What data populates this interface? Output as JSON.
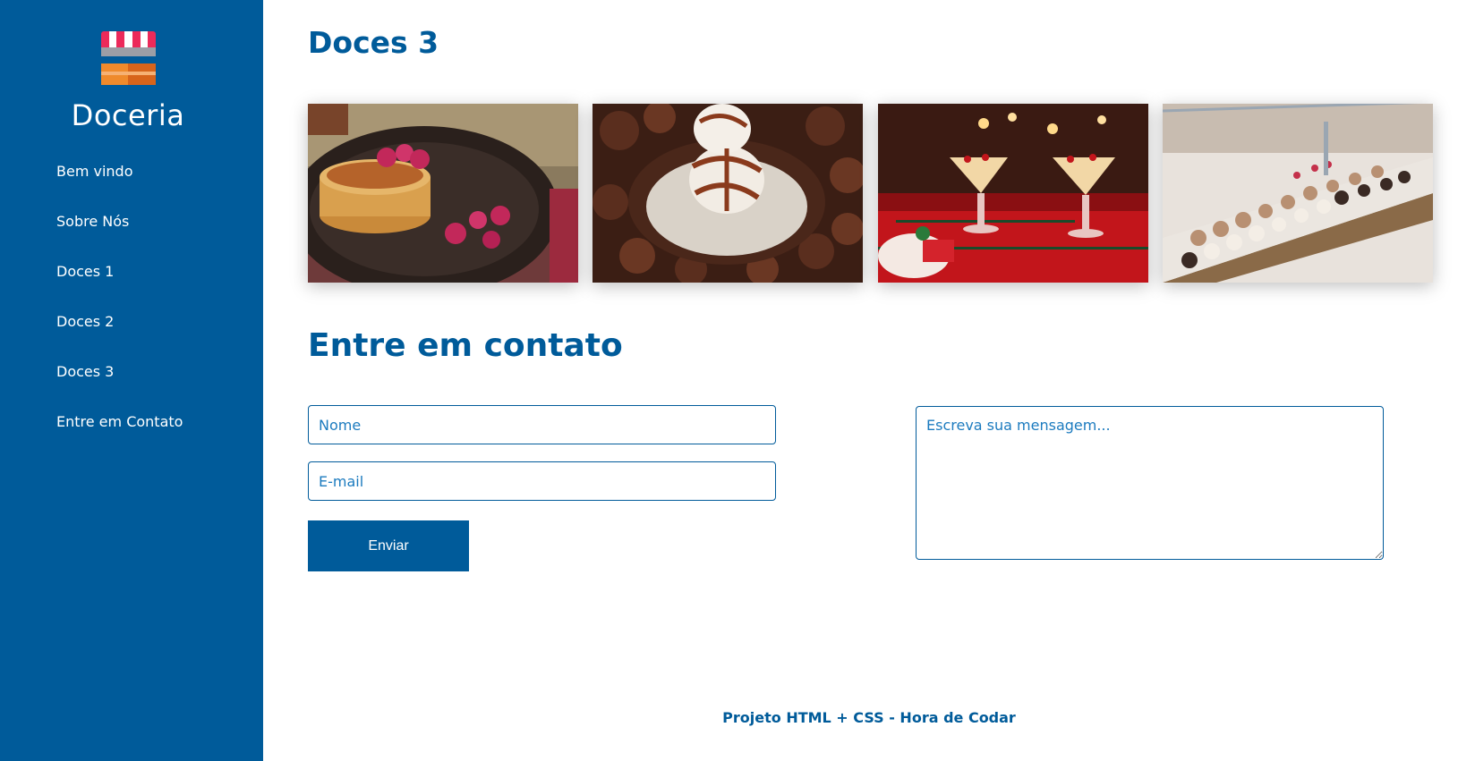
{
  "sidebar": {
    "brand": "Doceria",
    "logo_icon": "sweet-shop-stall-icon",
    "items": [
      {
        "label": "Bem vindo"
      },
      {
        "label": "Sobre Nós"
      },
      {
        "label": "Doces 1"
      },
      {
        "label": "Doces 2"
      },
      {
        "label": "Doces 3"
      },
      {
        "label": "Entre em Contato"
      }
    ]
  },
  "main": {
    "section_title": "Doces 3",
    "gallery": [
      {
        "name": "pancakes-with-raspberries-photo"
      },
      {
        "name": "chocolate-coconut-dessert-photo"
      },
      {
        "name": "christmas-eggnog-cocktails-photo"
      },
      {
        "name": "bakery-display-case-photo"
      }
    ],
    "contact": {
      "title": "Entre em contato",
      "name_placeholder": "Nome",
      "email_placeholder": "E-mail",
      "message_placeholder": "Escreva sua mensagem...",
      "submit_label": "Enviar"
    },
    "footer": "Projeto HTML + CSS - Hora de Codar"
  },
  "colors": {
    "primary": "#005b9a",
    "input_text": "#1c7bbf",
    "background": "#ffffff"
  }
}
